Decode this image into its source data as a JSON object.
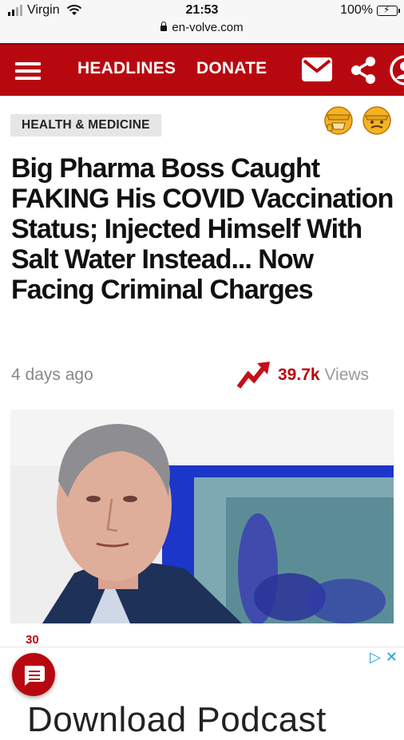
{
  "status_bar": {
    "carrier": "Virgin",
    "time": "21:53",
    "battery": "100%"
  },
  "browser": {
    "url": "en-volve.com"
  },
  "nav": {
    "headlines": "HEADLINES",
    "donate": "DONATE"
  },
  "article": {
    "category": "HEALTH & MEDICINE",
    "headline": "Big Pharma Boss Caught FAKING His COVID Vaccination Status; Injected Himself With Salt Water Instead... Now Facing Criminal Charges",
    "time_ago": "4 days ago",
    "views_count": "39.7k",
    "views_label": "Views",
    "comment_count": "30"
  },
  "ad": {
    "title": "Download Podcast"
  },
  "colors": {
    "brand": "#b8080f",
    "ad_accent": "#1aa3d9"
  }
}
